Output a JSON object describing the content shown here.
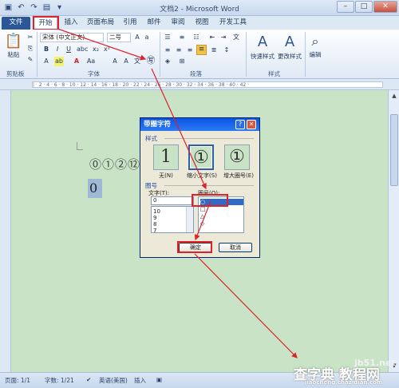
{
  "window": {
    "title": "文档2 - Microsoft Word",
    "quick_access": [
      "save-icon",
      "undo-icon",
      "redo-icon",
      "print-preview-icon",
      "customize-icon"
    ]
  },
  "tabs": [
    "文件",
    "开始",
    "插入",
    "页面布局",
    "引用",
    "邮件",
    "审阅",
    "视图",
    "开发工具"
  ],
  "ribbon": {
    "clipboard": {
      "paste_label": "粘贴",
      "group_label": "剪贴板"
    },
    "font": {
      "font_name": "宋体 (中文正文)",
      "font_size": "二号",
      "group_label": "字体",
      "enclose_char_glyph": "㊢"
    },
    "paragraph": {
      "group_label": "段落"
    },
    "styles": {
      "quick_styles_label": "快速样式",
      "change_styles_label": "更改样式",
      "group_label": "样式"
    },
    "editing": {
      "edit_label": "编辑"
    }
  },
  "document": {
    "circled_text": "⓪①②⑫",
    "selected_char": "0"
  },
  "dialog": {
    "title": "带圈字符",
    "help_button": "?",
    "style_section": "样式",
    "styles": [
      {
        "glyph": "1",
        "label": "无(N)"
      },
      {
        "glyph": "①",
        "label": "缩小文字(S)"
      },
      {
        "glyph": "①",
        "label": "增大圈号(E)"
      }
    ],
    "enclosure_section": "圈号",
    "text_label": "文字(T):",
    "enclosure_label": "圈号(O):",
    "text_value": "0",
    "text_list": [
      "0",
      "10",
      "9",
      "8",
      "7"
    ],
    "enclosure_list": [
      "○",
      "□",
      "△",
      "◇"
    ],
    "ok_label": "确定",
    "cancel_label": "取消"
  },
  "status": {
    "page": "页面: 1/1",
    "words": "字数: 1/21",
    "language": "英语(美国)",
    "insert_mode": "插入"
  },
  "watermark": {
    "site": "jb51.net",
    "brand": "查字典 教程网",
    "url": "jiaocheng.chazidian.com"
  },
  "colors": {
    "highlight_red": "#e0202a",
    "document_bg": "#c8e3c5",
    "dialog_title": "#0a54e3"
  }
}
